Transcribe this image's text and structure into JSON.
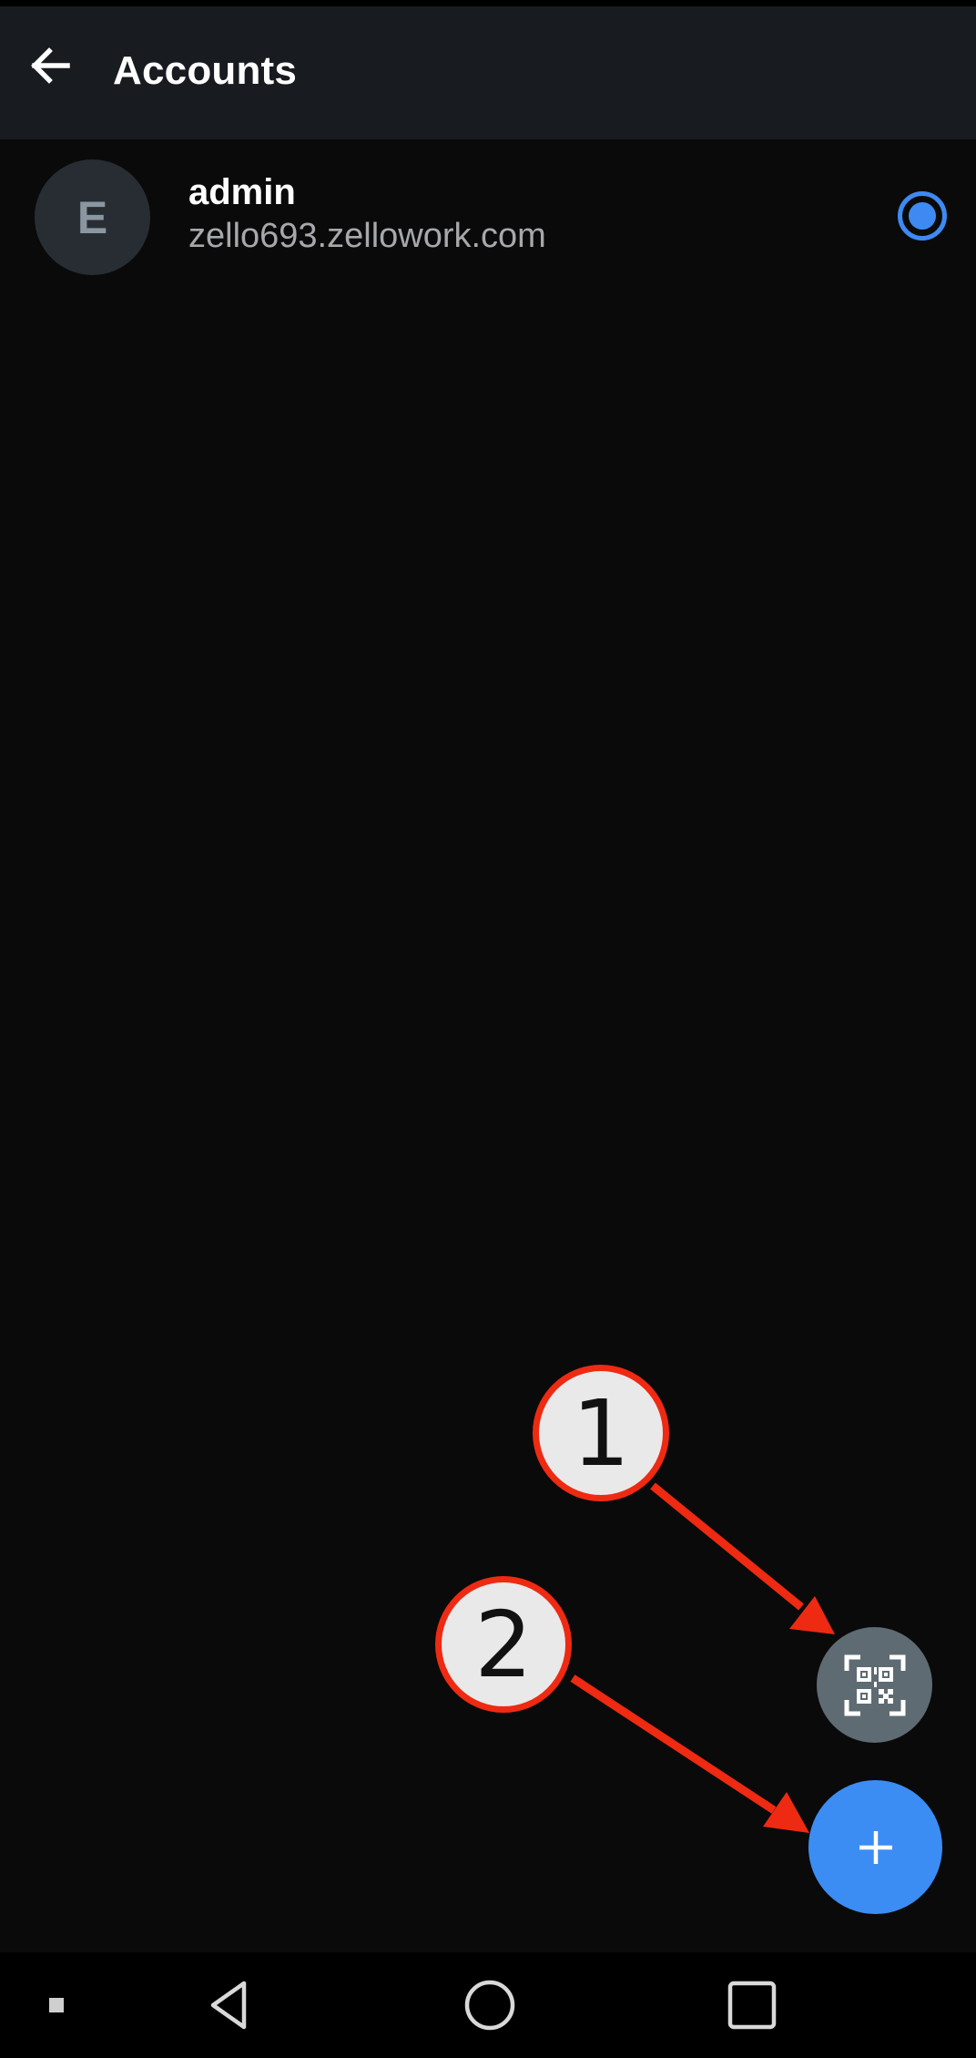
{
  "app_bar": {
    "title": "Accounts",
    "back_icon": "arrow-left-icon"
  },
  "accounts": [
    {
      "avatar_letter": "E",
      "name": "admin",
      "server": "zello693.zellowork.com",
      "selected": true
    }
  ],
  "fabs": {
    "scan_qr_icon": "qr-code-scan-icon",
    "add_icon": "plus-icon"
  },
  "annotations": {
    "callout_1": "1",
    "callout_2": "2"
  },
  "nav": {
    "icons": [
      "menu-square-icon",
      "back-triangle-icon",
      "home-circle-icon",
      "recents-square-icon"
    ]
  },
  "colors": {
    "accent": "#3b8df4",
    "app_bar_bg": "#181b1f",
    "background": "#0a0a0a",
    "qr_fab": "#5f6b72",
    "callout_border": "#ee2a12"
  }
}
